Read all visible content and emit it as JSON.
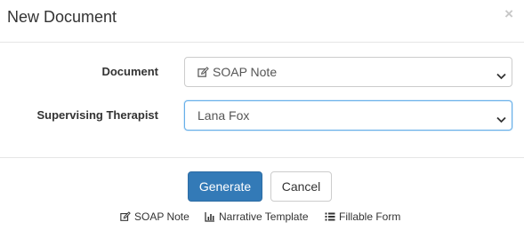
{
  "dialog": {
    "title": "New Document",
    "close_glyph": "×"
  },
  "form": {
    "document": {
      "label": "Document",
      "selected": "SOAP Note",
      "icon": "edit-icon"
    },
    "supervising_therapist": {
      "label": "Supervising Therapist",
      "selected": "Lana Fox"
    }
  },
  "footer": {
    "generate_label": "Generate",
    "cancel_label": "Cancel",
    "links": [
      {
        "label": "SOAP Note",
        "icon": "edit-icon"
      },
      {
        "label": "Narrative Template",
        "icon": "bar-chart-icon"
      },
      {
        "label": "Fillable Form",
        "icon": "list-icon"
      }
    ]
  },
  "colors": {
    "primary": "#337ab7",
    "focus_border": "#66afe9",
    "divider": "#e5e5e5"
  }
}
